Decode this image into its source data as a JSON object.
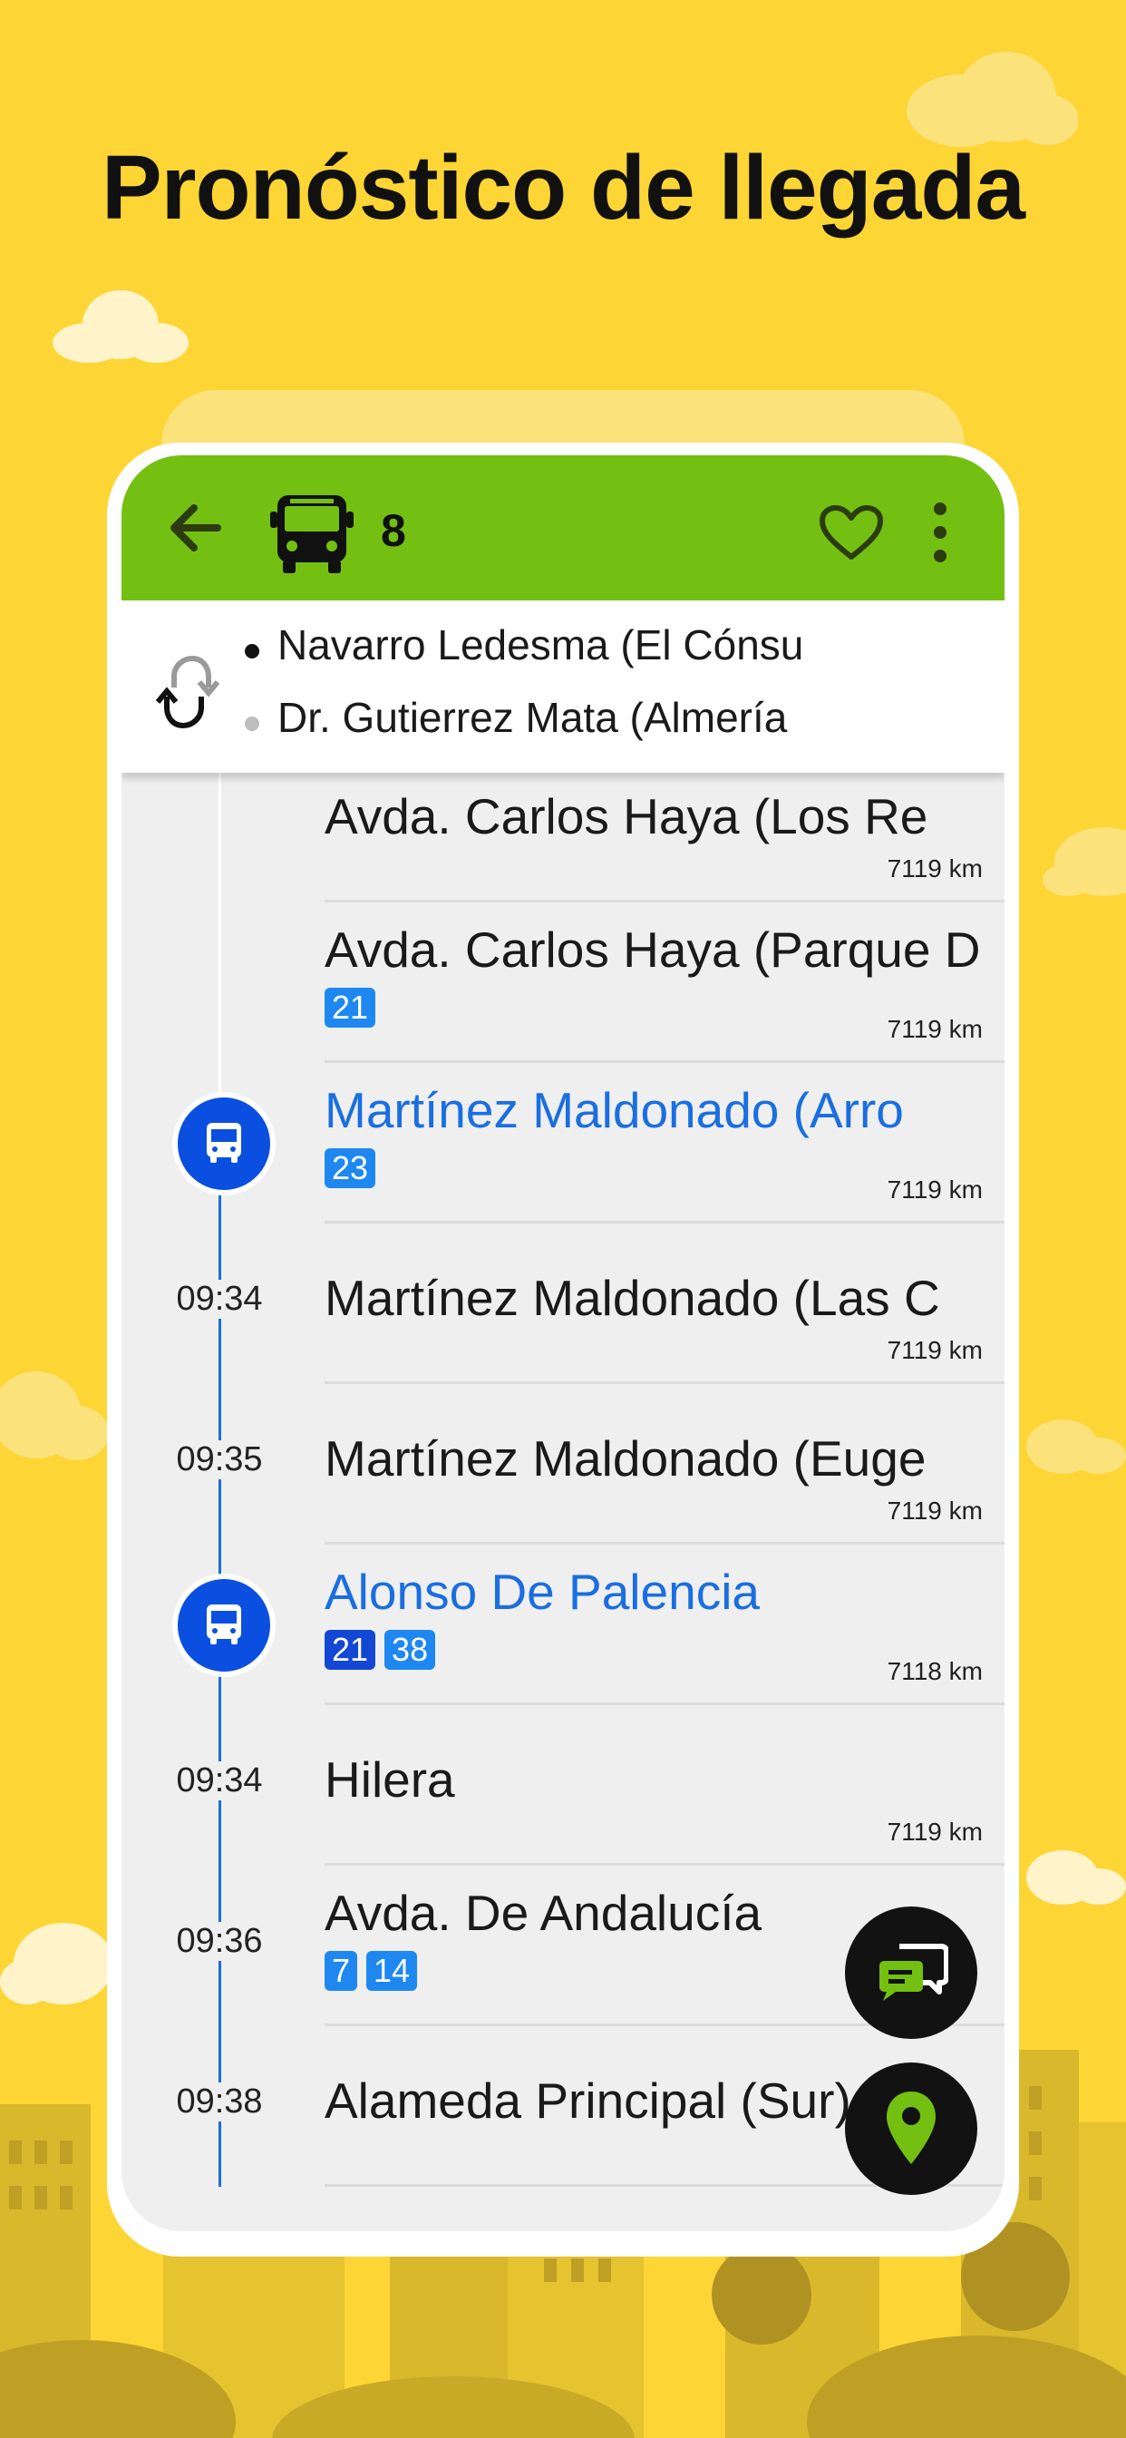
{
  "headline": "Pronóstico de llegada",
  "appbar": {
    "back_icon": "arrow-left-icon",
    "bus_icon": "bus-icon",
    "line_number": "8",
    "favorite_icon": "heart-outline-icon",
    "menu_icon": "more-vertical-icon",
    "color": "#73C012"
  },
  "directions": {
    "swap_icon": "swap-direction-icon",
    "origin": "Navarro Ledesma (El Cónsu",
    "destination": "Dr. Gutierrez Mata (Almería"
  },
  "stops": [
    {
      "name": "Avda. Carlos Haya (Los Re",
      "distance": "7119 km",
      "time": "",
      "lines": [],
      "highlight": false
    },
    {
      "name": "Avda. Carlos Haya (Parque D",
      "distance": "7119 km",
      "time": "",
      "lines": [
        "21"
      ],
      "highlight": false
    },
    {
      "name": "Martínez Maldonado (Arro",
      "distance": "7119 km",
      "time": "",
      "lines": [
        "23"
      ],
      "highlight": true
    },
    {
      "name": "Martínez Maldonado (Las C",
      "distance": "7119 km",
      "time": "09:34",
      "lines": [],
      "highlight": false
    },
    {
      "name": "Martínez Maldonado (Euge",
      "distance": "7119 km",
      "time": "09:35",
      "lines": [],
      "highlight": false
    },
    {
      "name": "Alonso De Palencia",
      "distance": "7118 km",
      "time": "",
      "lines": [
        "21",
        "38"
      ],
      "highlight": true
    },
    {
      "name": "Hilera",
      "distance": "7119 km",
      "time": "09:34",
      "lines": [],
      "highlight": false
    },
    {
      "name": "Avda. De Andalucía",
      "distance": "",
      "time": "09:36",
      "lines": [
        "7",
        "14"
      ],
      "highlight": false
    },
    {
      "name": "Alameda Principal (Sur)",
      "distance": "",
      "time": "09:38",
      "lines": [],
      "highlight": false
    }
  ],
  "fabs": {
    "chat_icon": "chat-bubbles-icon",
    "location_icon": "map-pin-icon"
  },
  "colors": {
    "background": "#FDD535",
    "accent_blue": "#1A6EE0",
    "bus_marker": "#0B4FE0",
    "pin_green": "#73C012"
  }
}
